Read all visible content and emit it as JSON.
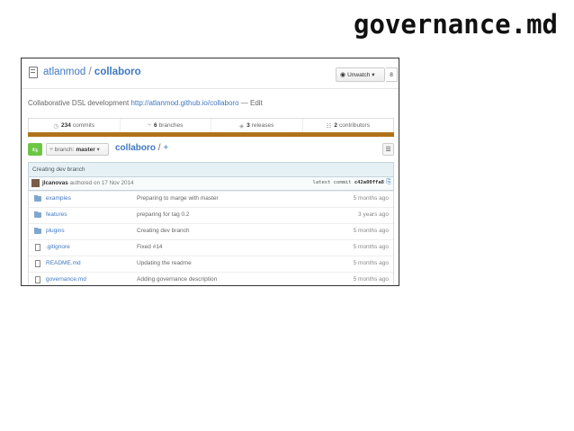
{
  "slide": {
    "title": "governance.md"
  },
  "repo": {
    "owner": "atlanmod",
    "separator": "/",
    "name": "collaboro",
    "watch_label": "Unwatch",
    "watch_caret": "▾",
    "watch_count": "8",
    "description": "Collaborative DSL development",
    "homepage": "http://atlanmod.github.io/collaboro",
    "edit_text": "— Edit"
  },
  "summary": {
    "commits_count": "234",
    "commits_label": "commits",
    "branches_count": "6",
    "branches_label": "branches",
    "releases_count": "3",
    "releases_label": "releases",
    "contributors_count": "2",
    "contributors_label": "contributors"
  },
  "language_bar_color": "#b07219",
  "toolbar": {
    "new_branch_glyph": "⇆",
    "branch_prefix": "branch:",
    "branch_name": "master",
    "branch_caret": "▾",
    "crumb_repo": "collaboro",
    "crumb_sep": "/",
    "crumb_plus": "+",
    "list_glyph": "☰"
  },
  "commit": {
    "message": "Creating dev branch",
    "author": "jlcanovas",
    "authored_text": "authored on 17 Nov 2014",
    "sha_label": "latest commit",
    "sha": "c42a00ffa8"
  },
  "files": [
    {
      "type": "folder",
      "name": "examples",
      "message": "Preparing to marge with master",
      "age": "5 months ago"
    },
    {
      "type": "folder",
      "name": "features",
      "message": "preparing for tag 0.2",
      "age": "3 years ago"
    },
    {
      "type": "folder",
      "name": "plugins",
      "message": "Creating dev branch",
      "age": "5 months ago"
    },
    {
      "type": "file",
      "name": ".gitignore",
      "message": "Fixed #14",
      "age": "5 months ago"
    },
    {
      "type": "file",
      "name": "README.md",
      "message": "Updating the readme",
      "age": "5 months ago"
    },
    {
      "type": "file",
      "name": "governance.md",
      "message": "Adding governance description",
      "age": "5 months ago"
    }
  ]
}
